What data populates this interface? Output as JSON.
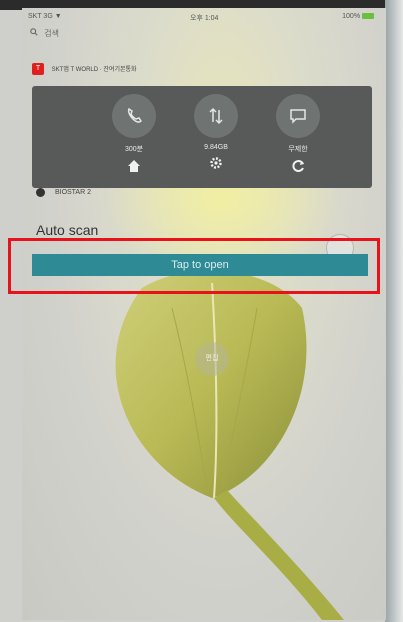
{
  "status_bar": {
    "carrier": "SKT 3G ▼",
    "time": "오후 1:04",
    "battery": "100%"
  },
  "search": {
    "label": "검색"
  },
  "tworld_widget": {
    "app_name": "SKT앱 T WORLD · 잔여기본통화",
    "call_value": "300분",
    "data_value": "9.84GB",
    "message_value": "무제한"
  },
  "notification": {
    "app_name": "BIOSTAR 2",
    "title": "Auto scan",
    "action_label": "Tap to open"
  },
  "wallpaper": {
    "edit_label": "편집"
  },
  "colors": {
    "action_bar": "#2e8a94",
    "highlight": "#e8121a",
    "widget_bg": "#585959"
  }
}
